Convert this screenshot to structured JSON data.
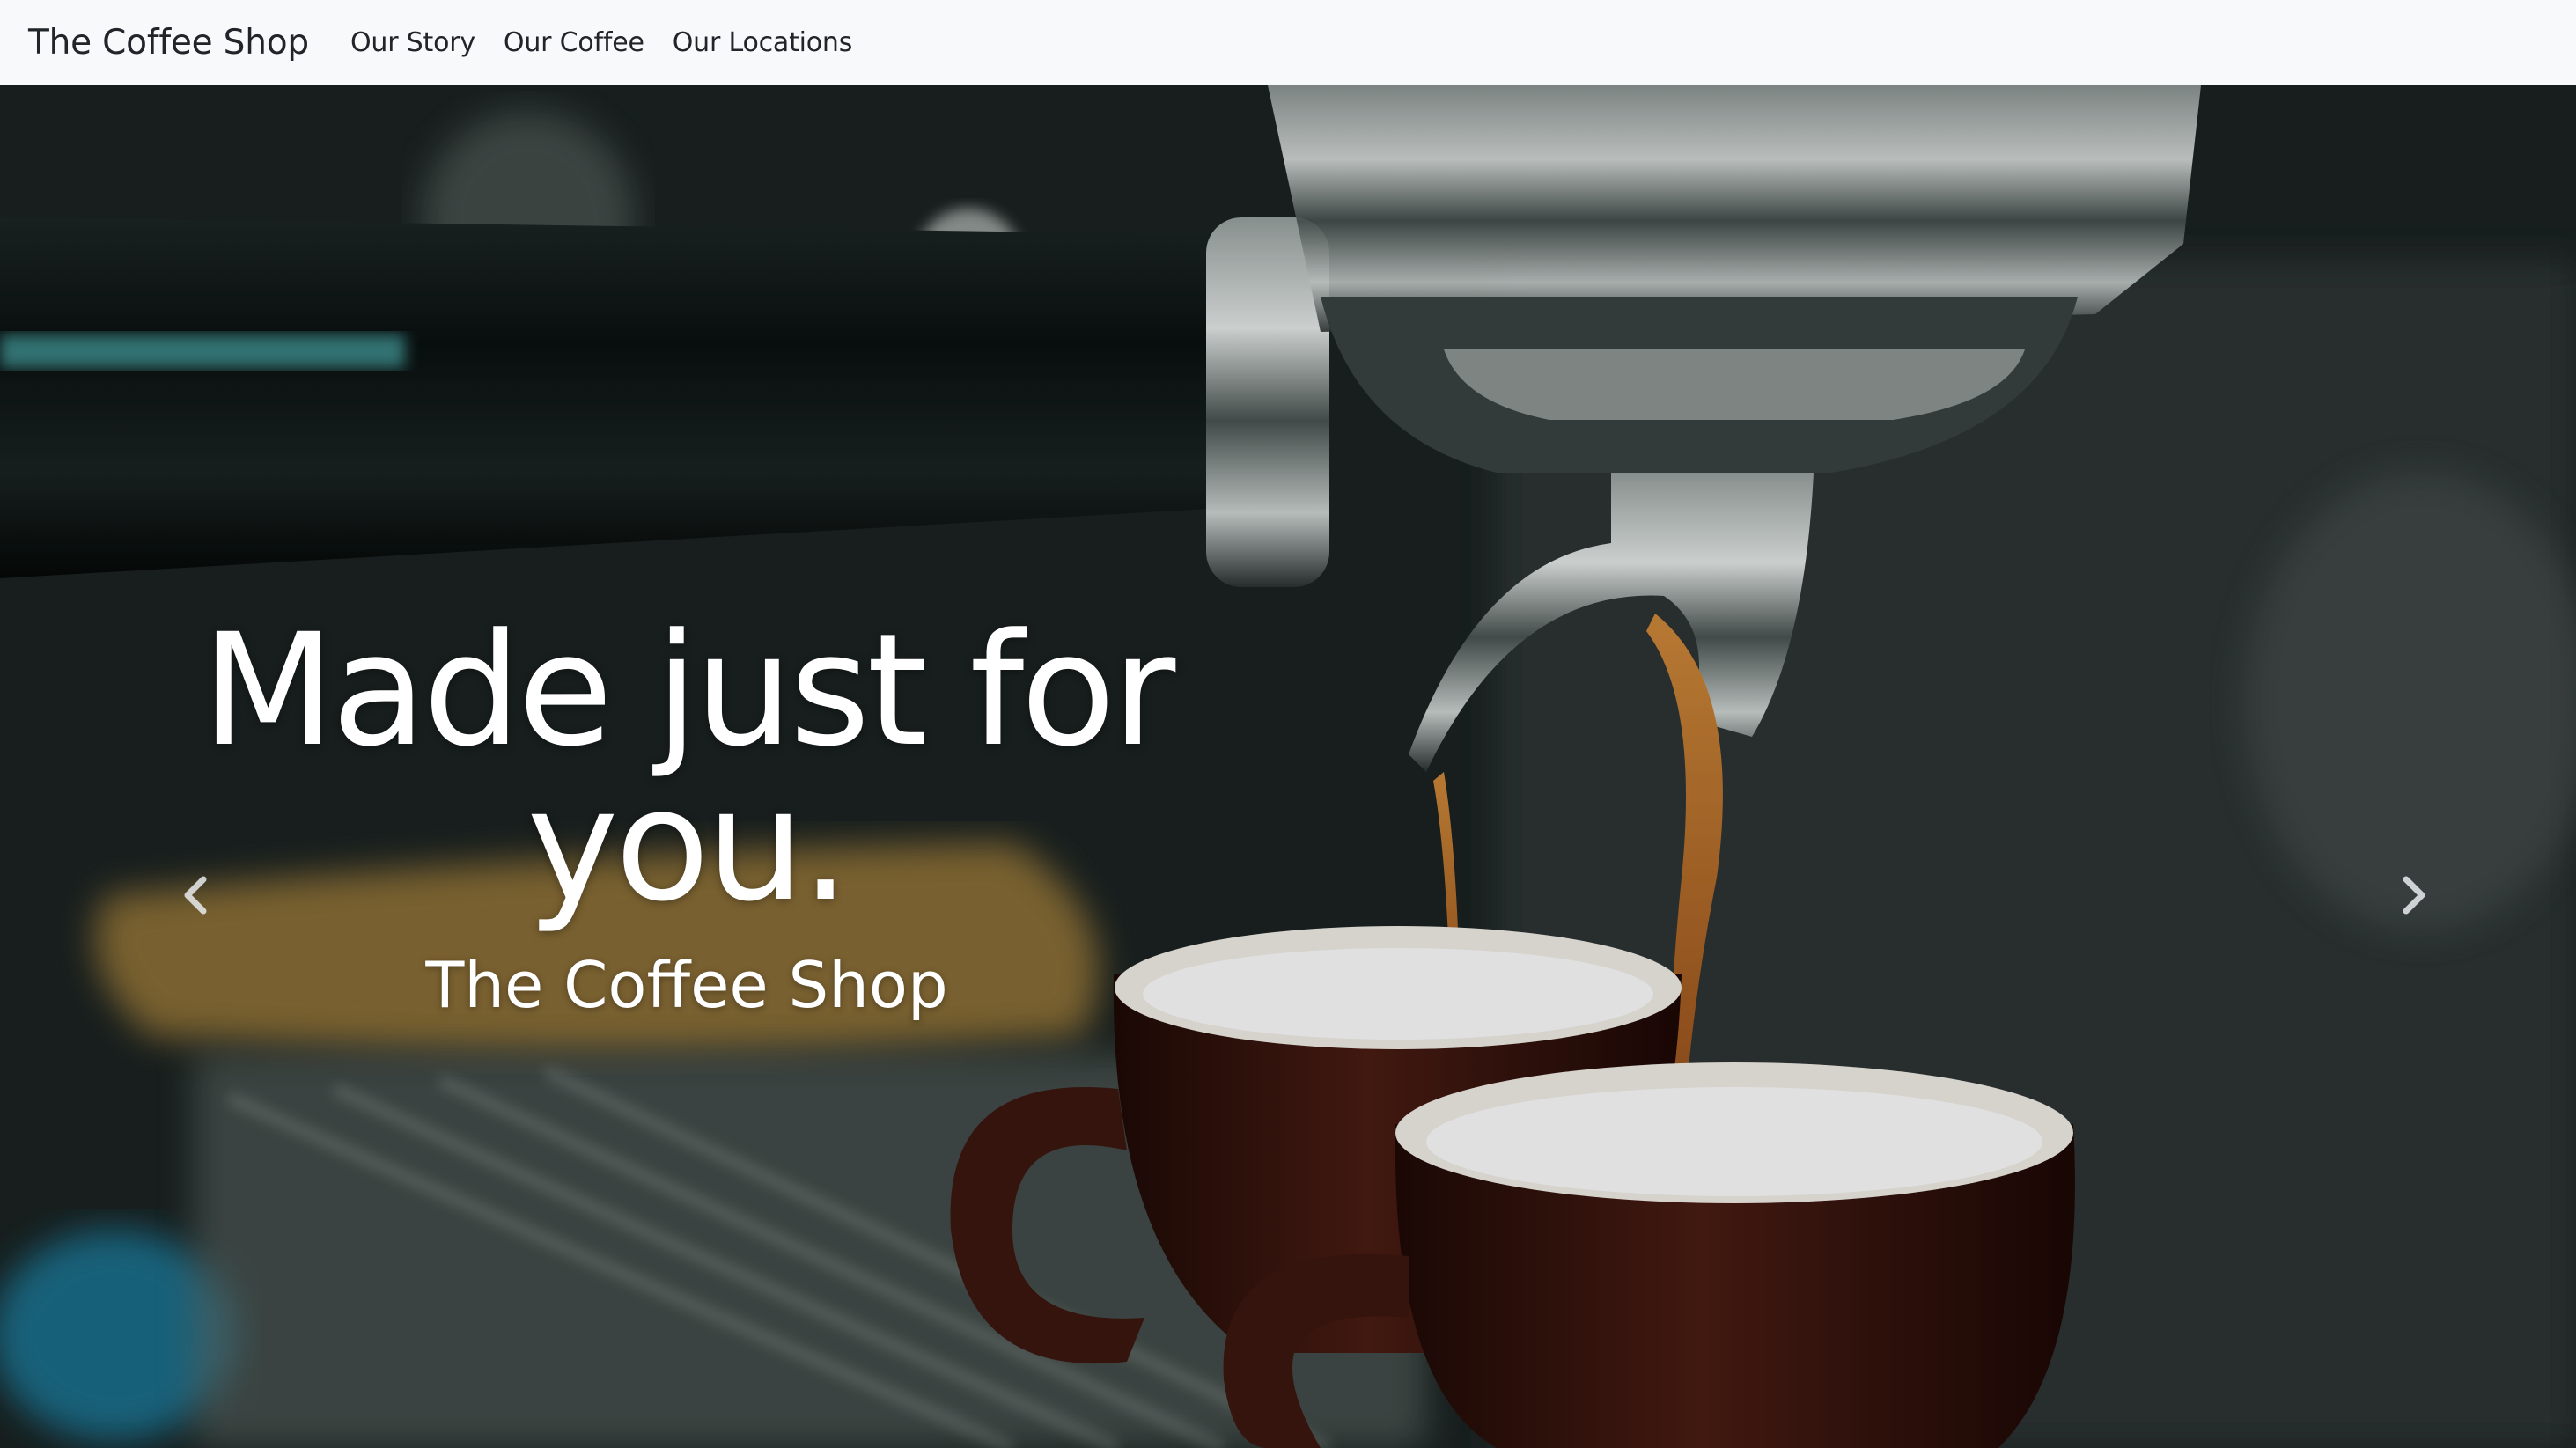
{
  "navbar": {
    "brand": "The Coffee Shop",
    "links": [
      "Our Story",
      "Our Coffee",
      "Our Locations"
    ]
  },
  "hero": {
    "title": "Made just for you.",
    "subtitle": "The Coffee Shop",
    "prev_icon": "chevron-left-icon",
    "next_icon": "chevron-right-icon"
  },
  "colors": {
    "navbar_bg": "#f8f9fa",
    "text_dark": "#212529",
    "hero_text": "#ffffff",
    "espresso": "#b5651d",
    "cup": "#3a1610"
  }
}
